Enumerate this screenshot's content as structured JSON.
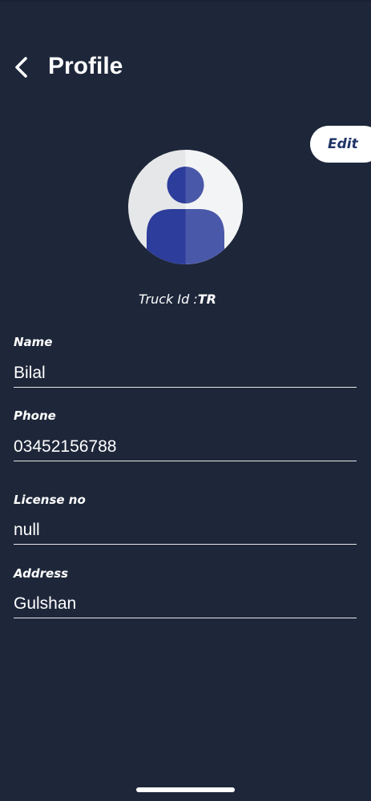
{
  "header": {
    "title": "Profile"
  },
  "profile": {
    "edit_label": "Edit",
    "truck_id_label": "Truck Id :",
    "truck_id_value": "TR"
  },
  "fields": {
    "name": {
      "label": "Name",
      "value": "Bilal"
    },
    "phone": {
      "label": "Phone",
      "value": "03452156788"
    },
    "license": {
      "label": "License no",
      "value": "null"
    },
    "address": {
      "label": "Address",
      "value": "Gulshan"
    }
  },
  "icons": {
    "back": "chevron-left-icon",
    "avatar": "person-avatar-icon"
  },
  "colors": {
    "background": "#1e273a",
    "avatar_person": "#2d3d9b",
    "edit_text": "#1e3366"
  }
}
